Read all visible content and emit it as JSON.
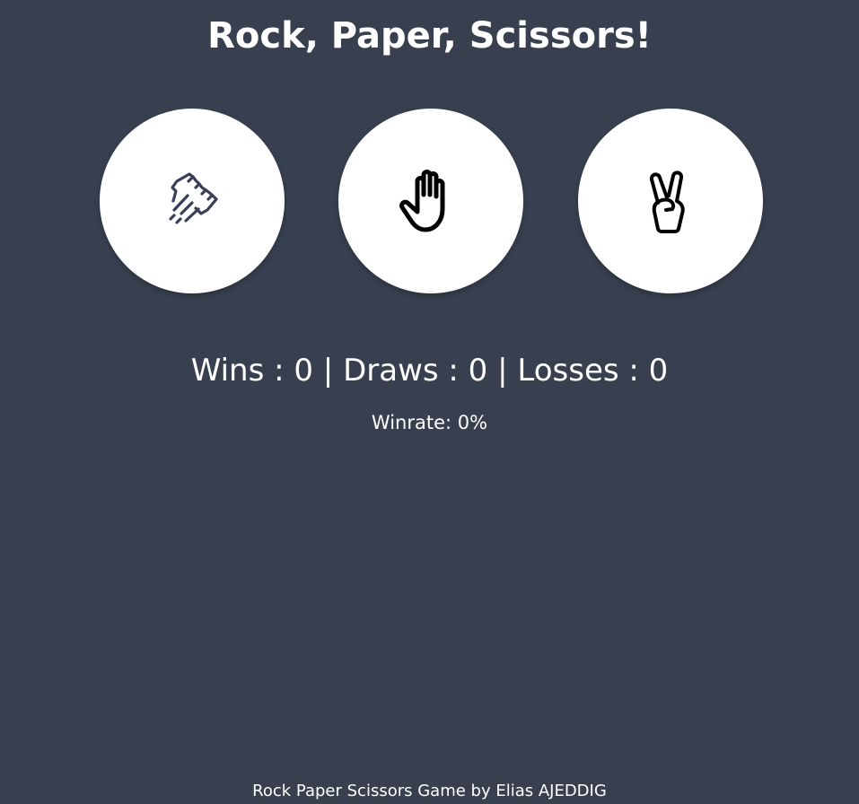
{
  "title": "Rock, Paper, Scissors!",
  "choices": [
    {
      "label": "rock",
      "icon": "rock-fist-icon"
    },
    {
      "label": "paper",
      "icon": "paper-hand-icon"
    },
    {
      "label": "scissors",
      "icon": "scissors-peace-icon"
    }
  ],
  "score": {
    "wins_label": "Wins : ",
    "wins": "0",
    "draws_label": " | Draws : ",
    "draws": "0",
    "losses_label": " | Losses : ",
    "losses": "0"
  },
  "winrate": {
    "label": "Winrate: ",
    "value": "0%"
  },
  "footer": "Rock Paper Scissors Game by Elias AJEDDIG",
  "colors": {
    "background": "#384050",
    "button": "#ffffff",
    "rock_icon": "#3a3f58",
    "icon": "#000000"
  }
}
